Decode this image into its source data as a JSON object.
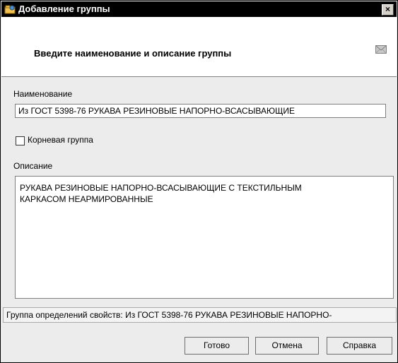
{
  "window": {
    "title": "Добавление группы",
    "close_glyph": "×"
  },
  "header": {
    "text": "Введите наименование и описание группы"
  },
  "form": {
    "name_label": "Наименование",
    "name_value": "Из ГОСТ 5398-76 РУКАВА РЕЗИНОВЫЕ НАПОРНО-ВСАСЫВАЮЩИЕ",
    "root_group_label": "Корневая группа",
    "root_group_checked": false,
    "description_label": "Описание",
    "description_value": "РУКАВА РЕЗИНОВЫЕ НАПОРНО-ВСАСЫВАЮЩИЕ С ТЕКСТИЛЬНЫМ\nКАРКАСОМ НЕАРМИРОВАННЫЕ"
  },
  "status": {
    "text": "Группа определений свойств: Из ГОСТ 5398-76 РУКАВА РЕЗИНОВЫЕ НАПОРНО-"
  },
  "buttons": {
    "ok_label": "Готово",
    "cancel_label": "Отмена",
    "help_label": "Справка"
  },
  "icons": {
    "title_icon": "group-icon",
    "header_icon": "envelope-icon",
    "close_icon": "close-icon",
    "checkbox": "checkbox-icon"
  }
}
